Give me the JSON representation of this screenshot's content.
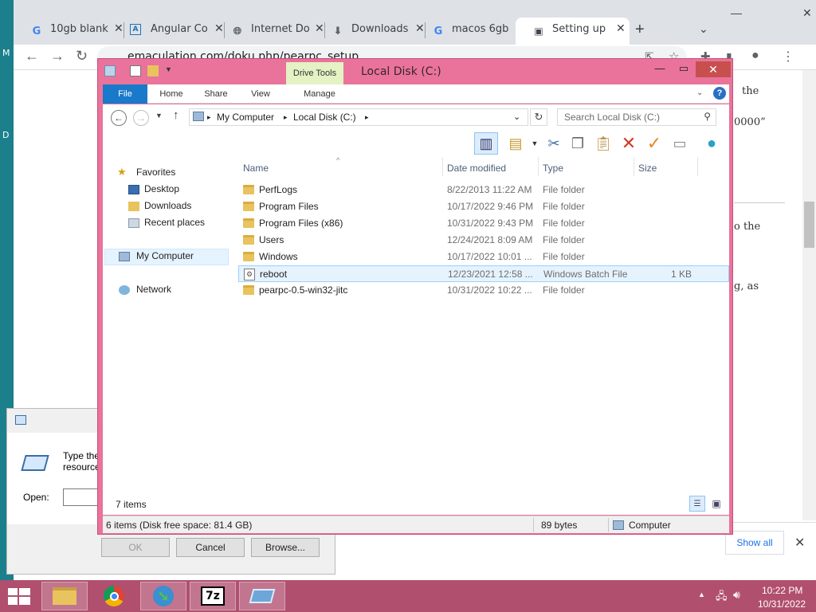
{
  "desktop": {
    "letter_m": "M",
    "letter_d": "D"
  },
  "browser": {
    "tabs": [
      {
        "favicon": "google-icon",
        "label": "10gb blank"
      },
      {
        "favicon": "angular-icon",
        "label": "Angular Co"
      },
      {
        "favicon": "globe-icon",
        "label": "Internet Do"
      },
      {
        "favicon": "download-icon",
        "label": "Downloads"
      },
      {
        "favicon": "google-icon",
        "label": "macos 6gb"
      },
      {
        "favicon": "page-icon",
        "label": "Setting up"
      }
    ],
    "url": "emaculation.com/doku.php/pearpc_setup",
    "page_fragments": {
      "frag1": "the",
      "frag2": "0000”",
      "frag3": "o the",
      "frag4": "g, as"
    },
    "download_bar": {
      "show_all": "Show all"
    }
  },
  "run_dialog": {
    "description": "Type the resource",
    "open_label": "Open:",
    "ok": "OK",
    "cancel": "Cancel",
    "browse": "Browse..."
  },
  "explorer": {
    "title": "Local Disk (C:)",
    "contextual_tab": "Drive Tools",
    "ribbon_tabs": [
      "File",
      "Home",
      "Share",
      "View",
      "Manage"
    ],
    "breadcrumbs": [
      "My Computer",
      "Local Disk (C:)"
    ],
    "search_placeholder": "Search Local Disk (C:)",
    "nav": {
      "favorites": "Favorites",
      "desktop": "Desktop",
      "downloads": "Downloads",
      "recent": "Recent places",
      "my_computer": "My Computer",
      "network": "Network"
    },
    "columns": {
      "name": "Name",
      "date": "Date modified",
      "type": "Type",
      "size": "Size"
    },
    "files": [
      {
        "name": "PerfLogs",
        "date": "8/22/2013 11:22 AM",
        "type": "File folder",
        "size": "",
        "icon": "folder-icon"
      },
      {
        "name": "Program Files",
        "date": "10/17/2022 9:46 PM",
        "type": "File folder",
        "size": "",
        "icon": "folder-icon"
      },
      {
        "name": "Program Files (x86)",
        "date": "10/31/2022 9:43 PM",
        "type": "File folder",
        "size": "",
        "icon": "folder-icon"
      },
      {
        "name": "Users",
        "date": "12/24/2021 8:09 AM",
        "type": "File folder",
        "size": "",
        "icon": "folder-icon"
      },
      {
        "name": "Windows",
        "date": "10/17/2022 10:01 ...",
        "type": "File folder",
        "size": "",
        "icon": "folder-icon"
      },
      {
        "name": "reboot",
        "date": "12/23/2021 12:58 ...",
        "type": "Windows Batch File",
        "size": "1 KB",
        "icon": "batch-file-icon",
        "selected": true
      },
      {
        "name": "pearpc-0.5-win32-jitc",
        "date": "10/31/2022 10:22 ...",
        "type": "File folder",
        "size": "",
        "icon": "folder-icon"
      }
    ],
    "item_count": "7 items",
    "status": {
      "summary": "6 items (Disk free space: 81.4 GB)",
      "size": "89 bytes",
      "location": "Computer"
    }
  },
  "taskbar": {
    "apps": [
      "file-explorer-icon",
      "chrome-icon",
      "internet-download-manager-icon",
      "7zip-icon",
      "run-icon"
    ],
    "time": "10:22 PM",
    "date": "10/31/2022"
  },
  "colors": {
    "explorer_frame": "#e9739b",
    "taskbar": "#b14f6f",
    "desktop": "#1b7f8c",
    "ribbon_file": "#1979ca",
    "selection": "#e5f3ff"
  }
}
